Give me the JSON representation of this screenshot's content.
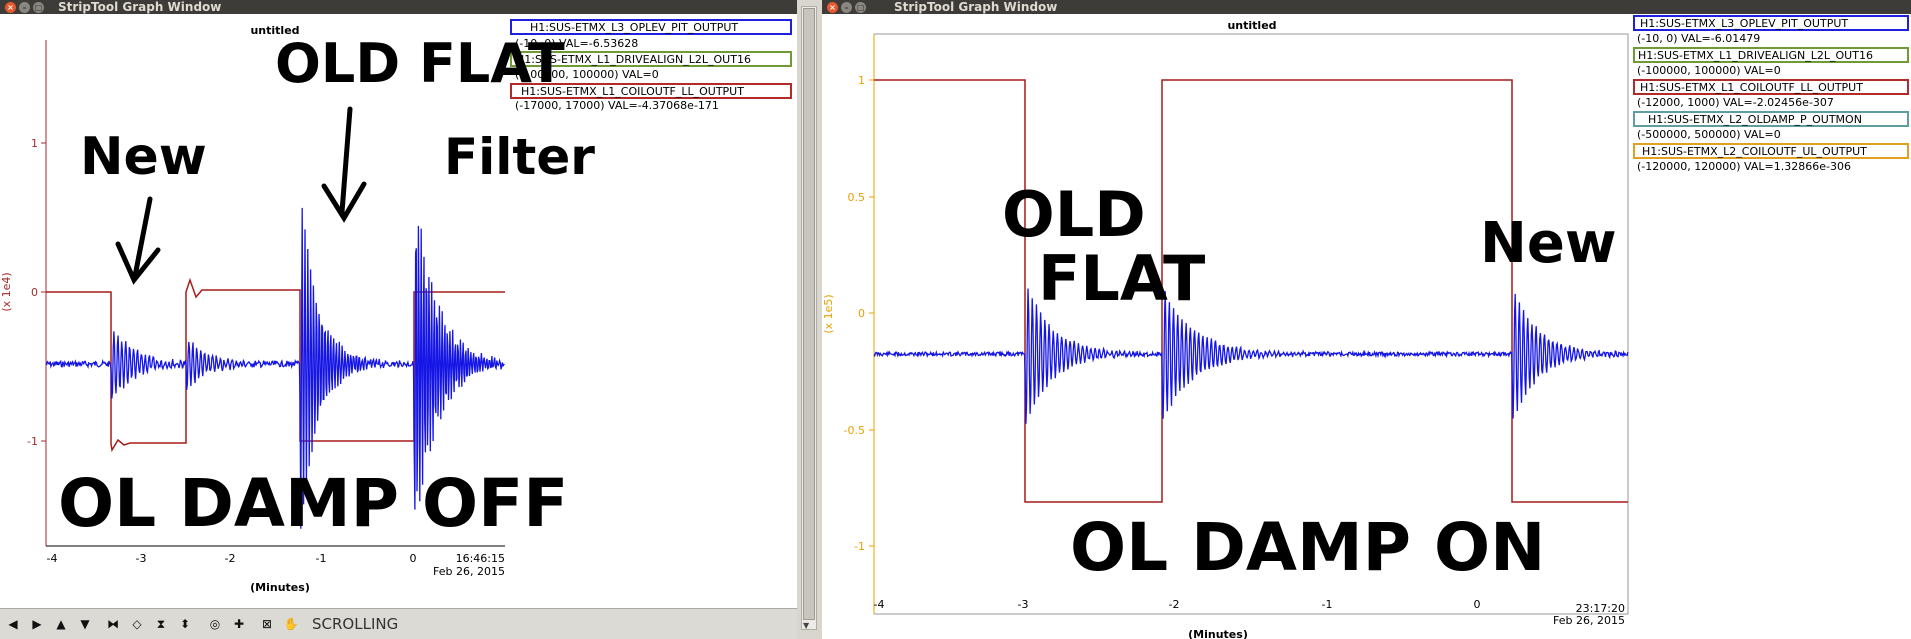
{
  "window_title": "StripTool Graph Window",
  "left": {
    "plot_title": "untitled",
    "y_axis_label": "(x 1e4)",
    "y_ticks": [
      "1",
      "0",
      "-1"
    ],
    "x_ticks": [
      "-4",
      "-3",
      "-2",
      "-1",
      "0"
    ],
    "x_label": "(Minutes)",
    "time": "16:46:15",
    "date": "Feb 26, 2015",
    "legend": [
      {
        "name": "H1:SUS-ETMX_L3_OPLEV_PIT_OUTPUT",
        "range": "(-10, 0) VAL=-6.53628",
        "color": "#1f1fe0"
      },
      {
        "name": "H1:SUS-ETMX_L1_DRIVEALIGN_L2L_OUT16",
        "range": "(-100000, 100000) VAL=0",
        "color": "#6f9a35"
      },
      {
        "name": "H1:SUS-ETMX_L1_COILOUTF_LL_OUTPUT",
        "range": "(-17000, 17000) VAL=-4.37068e-171",
        "color": "#b22a2a"
      }
    ],
    "annotations": {
      "new": "New",
      "old_flat": "OLD FLAT",
      "filter": "Filter",
      "state": "OL DAMP OFF"
    },
    "toolbar_status": "SCROLLING"
  },
  "right": {
    "plot_title": "untitled",
    "y_axis_label": "(x 1e5)",
    "y_ticks": [
      "1",
      "0.5",
      "0",
      "-0.5",
      "-1"
    ],
    "x_ticks": [
      "-4",
      "-3",
      "-2",
      "-1",
      "0"
    ],
    "x_label": "(Minutes)",
    "time": "23:17:20",
    "date": "Feb 26, 2015",
    "legend": [
      {
        "name": "H1:SUS-ETMX_L3_OPLEV_PIT_OUTPUT",
        "range": "(-10, 0) VAL=-6.01479",
        "color": "#1f1fe0"
      },
      {
        "name": "H1:SUS-ETMX_L1_DRIVEALIGN_L2L_OUT16",
        "range": "(-100000, 100000) VAL=0",
        "color": "#6f9a35"
      },
      {
        "name": "H1:SUS-ETMX_L1_COILOUTF_LL_OUTPUT",
        "range": "(-12000, 1000) VAL=-2.02456e-307",
        "color": "#b22a2a"
      },
      {
        "name": "H1:SUS-ETMX_L2_OLDAMP_P_OUTMON",
        "range": "(-500000, 500000) VAL=0",
        "color": "#5f9ea0"
      },
      {
        "name": "H1:SUS-ETMX_L2_COILOUTF_UL_OUTPUT",
        "range": "(-120000, 120000) VAL=1.32866e-306",
        "color": "#e0a020"
      }
    ],
    "annotations": {
      "old": "OLD",
      "flat": "FLAT",
      "new": "New",
      "state": "OL DAMP ON"
    }
  },
  "colors": {
    "blue_trace": "#1515e6",
    "red_trace": "#a51c1c",
    "left_axis": "#a52a2a",
    "right_axis": "#e8a000"
  }
}
